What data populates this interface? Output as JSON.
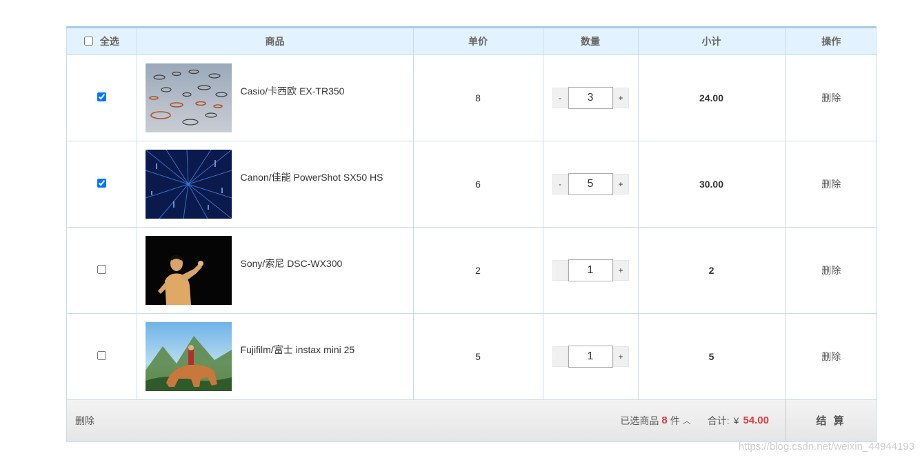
{
  "header": {
    "select_all_label": "全选",
    "col_goods": "商品",
    "col_price": "单价",
    "col_qty": "数量",
    "col_subtotal": "小计",
    "col_action": "操作"
  },
  "rows": [
    {
      "checked": true,
      "name": "Casio/卡西欧 EX-TR350",
      "price": "8",
      "qty": "3",
      "minus": "-",
      "plus": "+",
      "subtotal": "24.00",
      "action": "删除"
    },
    {
      "checked": true,
      "name": "Canon/佳能 PowerShot SX50 HS",
      "price": "6",
      "qty": "5",
      "minus": "-",
      "plus": "+",
      "subtotal": "30.00",
      "action": "删除"
    },
    {
      "checked": false,
      "name": "Sony/索尼 DSC-WX300",
      "price": "2",
      "qty": "1",
      "minus": "-",
      "plus": "+",
      "subtotal": "2",
      "action": "删除"
    },
    {
      "checked": false,
      "name": "Fujifilm/富士 instax mini 25",
      "price": "5",
      "qty": "1",
      "minus": "-",
      "plus": "+",
      "subtotal": "5",
      "action": "删除"
    }
  ],
  "footer": {
    "delete_label": "删除",
    "selected_prefix": "已选商品",
    "selected_count": "8",
    "selected_unit": "件",
    "arrow": "︿",
    "total_label": "合计:",
    "currency": "¥",
    "total_amount": "54.00",
    "checkout_label": "结 算"
  },
  "watermark": "https://blog.csdn.net/weixin_44944193",
  "colors": {
    "header_bg": "#e2f2fe",
    "border": "#c8dcec",
    "accent_red": "#e4393c"
  },
  "icons": {
    "arrow": "chevron-up-icon"
  }
}
